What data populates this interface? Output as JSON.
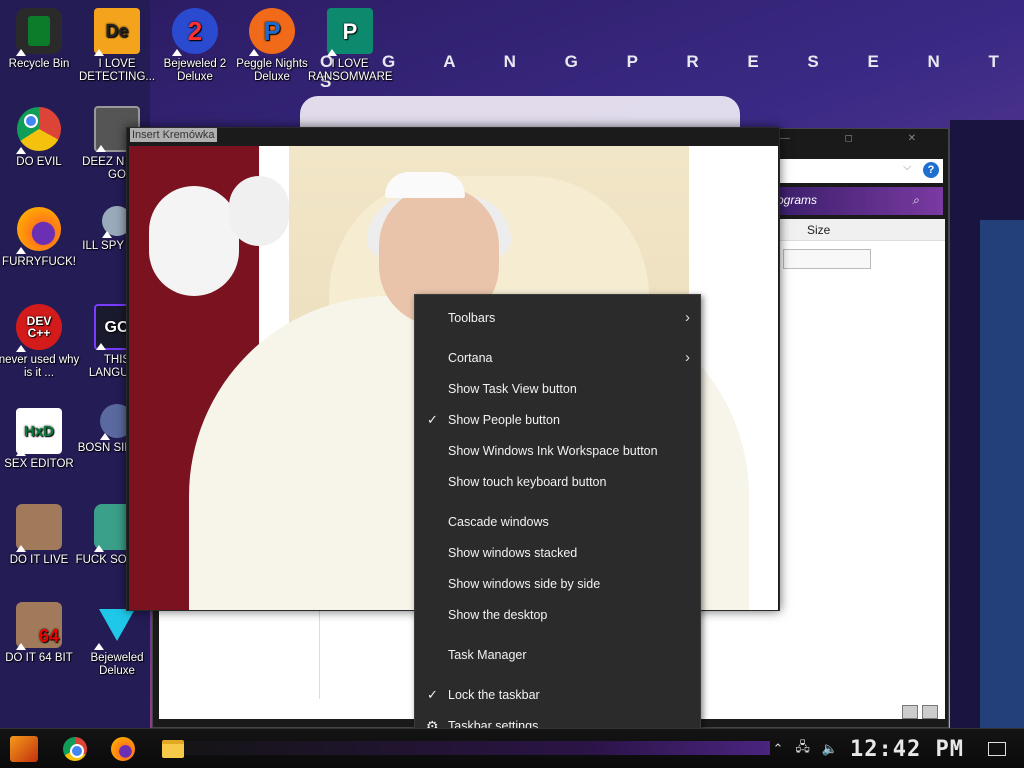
{
  "desktop": {
    "icons": [
      {
        "label": "Recycle Bin"
      },
      {
        "label": "I LOVE DETECTING...",
        "glyph": "De"
      },
      {
        "label": "Bejeweled 2 Deluxe",
        "glyph": "2"
      },
      {
        "label": "Peggle Nights Deluxe",
        "glyph": "P"
      },
      {
        "label": "I LOVE RANSOMWARE",
        "glyph": "P"
      },
      {
        "label": "DO EVIL"
      },
      {
        "label": "DEEZ N HAH GO"
      },
      {
        "label": "FURRYFUCK!"
      },
      {
        "label": "ILL SPY YOU"
      },
      {
        "label": "never used why is it ...",
        "glyph": "DEV C++"
      },
      {
        "label": "THIS LANGUAG",
        "glyph": "GO"
      },
      {
        "label": "SEX EDITOR",
        "glyph": "HxD"
      },
      {
        "label": "BOSN SIMULA"
      },
      {
        "label": "DO IT LIVE"
      },
      {
        "label": "FUCK SO ELVE"
      },
      {
        "label": "DO IT 64 BIT",
        "glyph": "64"
      },
      {
        "label": "Bejeweled Deluxe"
      }
    ]
  },
  "wallpaper": {
    "text": "O G A N G   P R E S E N T S"
  },
  "explorer": {
    "size_header": "Size",
    "search_placeholder": "ograms",
    "help_label": "?"
  },
  "viewer": {
    "title": "Insert Kremówka"
  },
  "context_menu": {
    "items": [
      {
        "label": "Toolbars",
        "has_submenu": true,
        "checked": false
      },
      {
        "label": "Cortana",
        "has_submenu": true,
        "checked": false
      },
      {
        "label": "Show Task View button",
        "checked": false
      },
      {
        "label": "Show People button",
        "checked": true
      },
      {
        "label": "Show Windows Ink Workspace button",
        "checked": false
      },
      {
        "label": "Show touch keyboard button",
        "checked": false
      },
      {
        "label": "Cascade windows",
        "checked": false
      },
      {
        "label": "Show windows stacked",
        "checked": false
      },
      {
        "label": "Show windows side by side",
        "checked": false
      },
      {
        "label": "Show the desktop",
        "checked": false
      },
      {
        "label": "Task Manager",
        "checked": false
      },
      {
        "label": "Lock the taskbar",
        "checked": true
      },
      {
        "label": "Taskbar settings",
        "icon": "gear-icon"
      }
    ]
  },
  "taskbar": {
    "clock": "12:42 PM"
  },
  "colors": {
    "menu_bg": "#2b2b2b",
    "taskbar_bg": "#0f0f0f",
    "accent_purple": "#4a2480"
  }
}
